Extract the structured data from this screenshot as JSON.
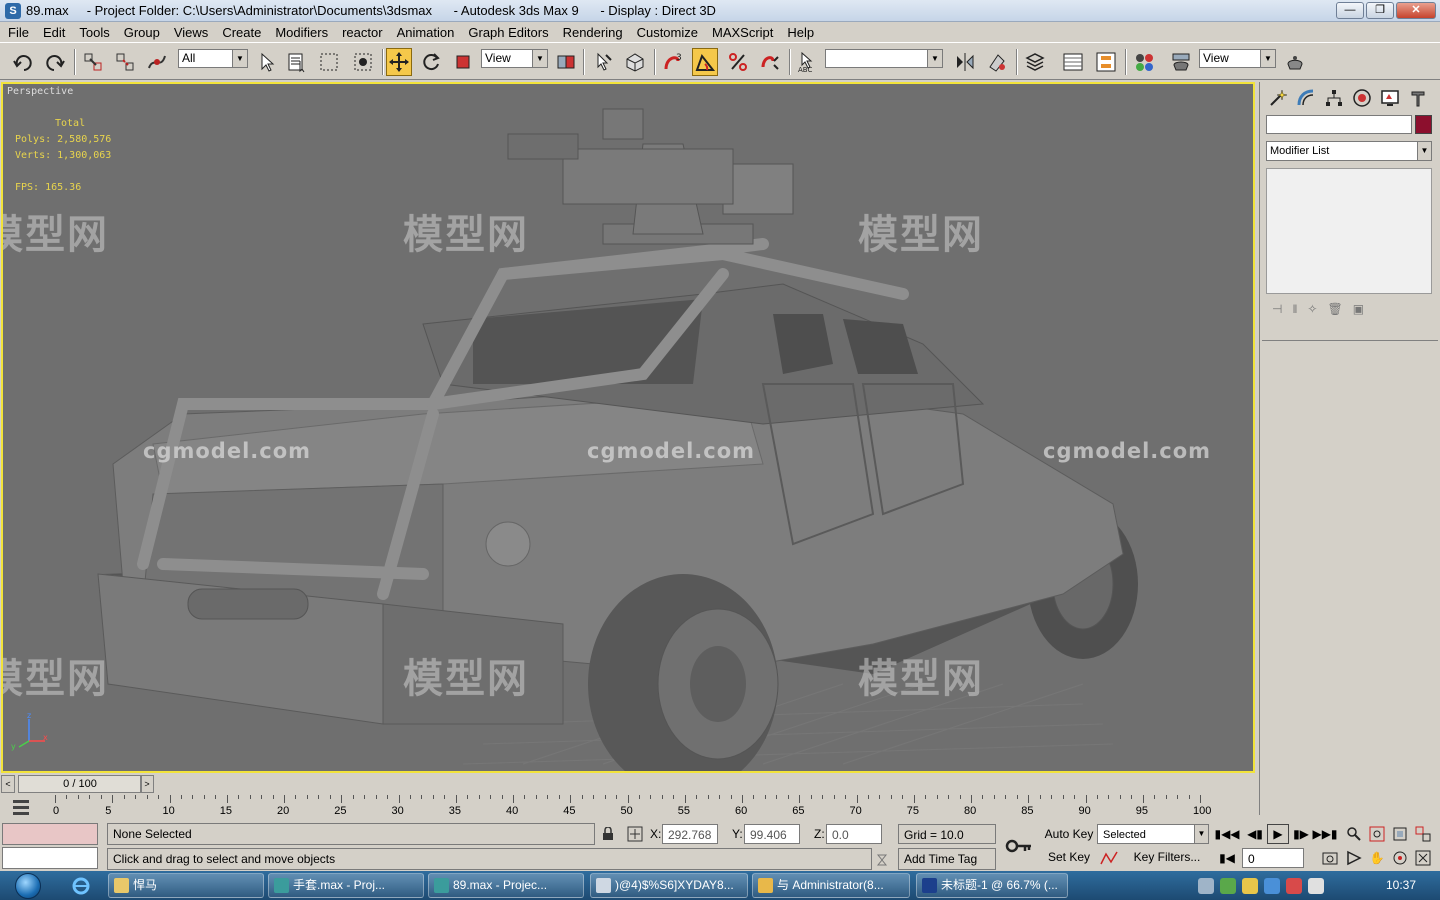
{
  "window": {
    "title": "89.max     - Project Folder: C:\\Users\\Administrator\\Documents\\3dsmax      - Autodesk 3ds Max 9      - Display : Direct 3D",
    "minimize": "—",
    "maximize": "❐",
    "close": "✕"
  },
  "menu": [
    "File",
    "Edit",
    "Tools",
    "Group",
    "Views",
    "Create",
    "Modifiers",
    "reactor",
    "Animation",
    "Graph Editors",
    "Rendering",
    "Customize",
    "MAXScript",
    "Help"
  ],
  "toolbar": {
    "selection_filter": "All",
    "ref_coord": "View",
    "named_selection": "",
    "view_dropdown": "View"
  },
  "viewport": {
    "label": "Perspective",
    "stats_title": "Total",
    "polys": "Polys: 2,580,576",
    "verts": "Verts: 1,300,063",
    "fps": "FPS:   165.36",
    "axis_x": "x",
    "axis_y": "y",
    "axis_z": "z",
    "wm_cn": "模型网",
    "wm_en": "cgmodel.com"
  },
  "command_panel": {
    "modifier_list": "Modifier List"
  },
  "time_slider": {
    "position": "0 / 100",
    "prev": "<",
    "next": ">"
  },
  "trackbar": {
    "numbers": [
      "0",
      "5",
      "10",
      "15",
      "20",
      "25",
      "30",
      "35",
      "40",
      "45",
      "50",
      "55",
      "60",
      "65",
      "70",
      "75",
      "80",
      "85",
      "90",
      "95",
      "100"
    ]
  },
  "status": {
    "selection": "None Selected",
    "prompt": "Click and drag to select and move objects",
    "x_label": "X:",
    "x_value": "292.768",
    "y_label": "Y:",
    "y_value": "99.406",
    "z_label": "Z:",
    "z_value": "0.0",
    "grid": "Grid = 10.0",
    "add_time_tag": "Add Time Tag",
    "auto_key": "Auto Key",
    "set_key": "Set Key",
    "key_mode": "Selected",
    "key_filters": "Key Filters...",
    "frame": "0"
  },
  "taskbar": {
    "items": [
      {
        "label": "悍马",
        "color": "#e8c86a"
      },
      {
        "label": "手套.max      - Proj...",
        "color": "#3b9c9c"
      },
      {
        "label": "89.max        - Projec...",
        "color": "#3b9c9c"
      },
      {
        "label": ")@4)$%S6]XYDAY8...",
        "color": "#cfd8e3"
      },
      {
        "label": "与 Administrator(8...",
        "color": "#e8b84a"
      },
      {
        "label": "未标题-1 @ 66.7% (...",
        "color": "#1c3f8c"
      }
    ],
    "clock": "10:37"
  }
}
